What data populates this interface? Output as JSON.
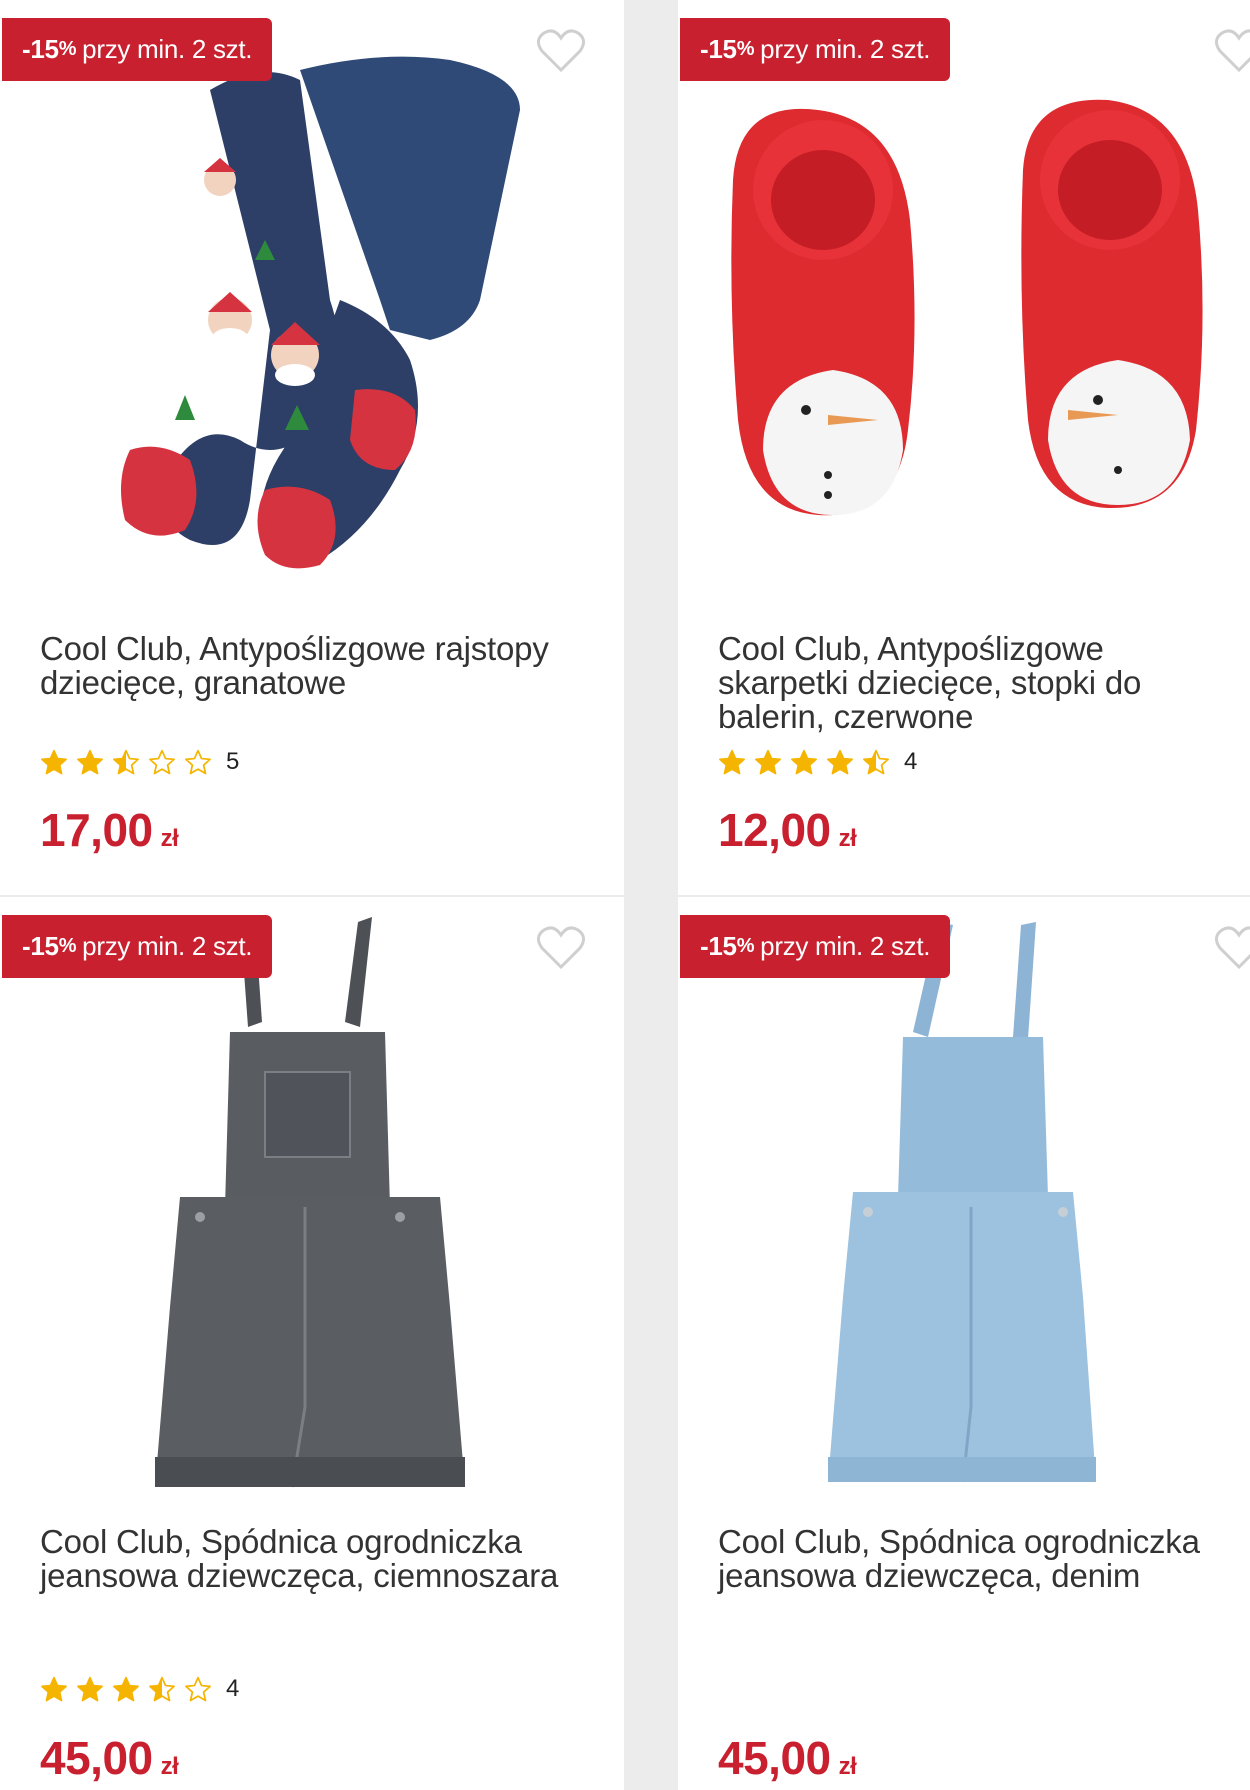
{
  "products": [
    {
      "promo_value": "-15",
      "promo_pct": "%",
      "promo_text": "przy min. 2 szt.",
      "title": "Cool Club, Antypoślizgowe rajstopy dziecięce, granatowe",
      "rating": 2.5,
      "rating_count": "5",
      "price": "17,00",
      "currency": "zł",
      "image": "navy-christmas-tights"
    },
    {
      "promo_value": "-15",
      "promo_pct": "%",
      "promo_text": "przy min. 2 szt.",
      "title": "Cool Club, Antypoślizgowe skarpetki dziecięce, stopki do balerin, czerwone",
      "rating": 4.5,
      "rating_count": "4",
      "price": "12,00",
      "currency": "zł",
      "image": "red-snowman-socks"
    },
    {
      "promo_value": "-15",
      "promo_pct": "%",
      "promo_text": "przy min. 2 szt.",
      "title": "Cool Club, Spódnica ogrodniczka jeansowa dziewczęca, ciemnoszara",
      "rating": 3.5,
      "rating_count": "4",
      "price": "45,00",
      "currency": "zł",
      "image": "dark-grey-denim-dungaree-skirt"
    },
    {
      "promo_value": "-15",
      "promo_pct": "%",
      "promo_text": "przy min. 2 szt.",
      "title": "Cool Club, Spódnica ogrodniczka jeansowa dziewczęca, denim",
      "rating": null,
      "rating_count": "",
      "price": "45,00",
      "currency": "zł",
      "image": "light-blue-denim-dungaree-skirt"
    }
  ],
  "colors": {
    "accent_red": "#c8202f",
    "star_gold": "#f5b400",
    "background": "#ececec"
  }
}
